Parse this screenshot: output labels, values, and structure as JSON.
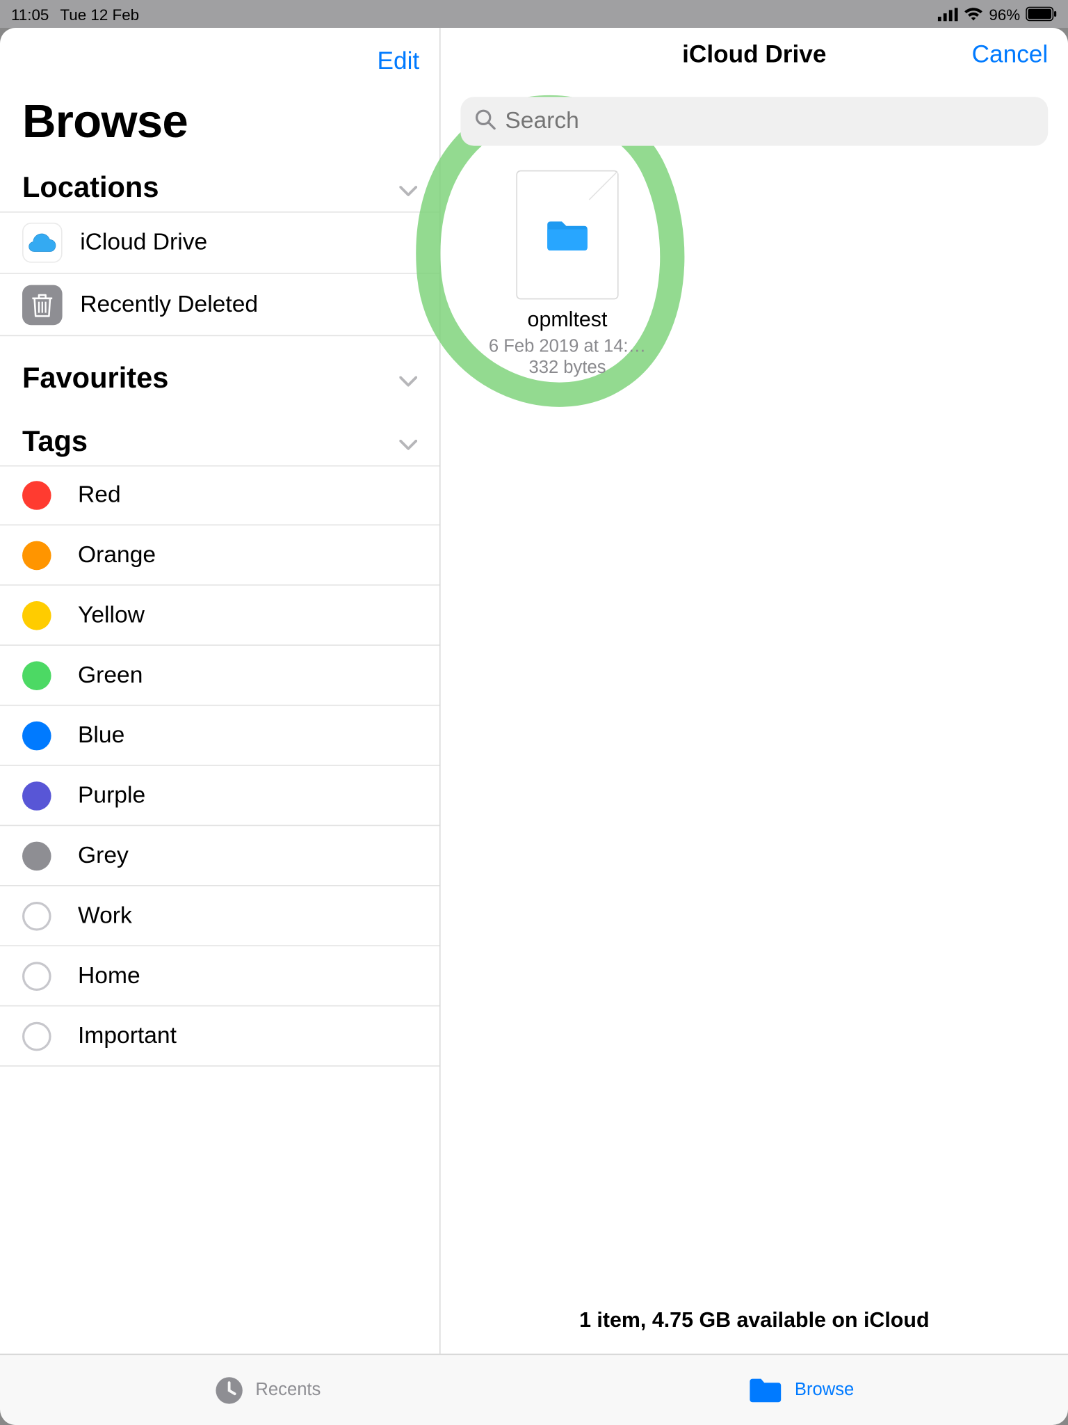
{
  "status_bar": {
    "time": "11:05",
    "date": "Tue 12 Feb",
    "battery_percent": "96%"
  },
  "sidebar": {
    "edit_label": "Edit",
    "title": "Browse",
    "sections": {
      "locations_label": "Locations",
      "favourites_label": "Favourites",
      "tags_label": "Tags"
    },
    "locations": [
      {
        "label": "iCloud Drive"
      },
      {
        "label": "Recently Deleted"
      }
    ],
    "tags": [
      {
        "label": "Red",
        "color": "#ff3b30",
        "filled": true
      },
      {
        "label": "Orange",
        "color": "#ff9500",
        "filled": true
      },
      {
        "label": "Yellow",
        "color": "#ffcc00",
        "filled": true
      },
      {
        "label": "Green",
        "color": "#4cd964",
        "filled": true
      },
      {
        "label": "Blue",
        "color": "#007aff",
        "filled": true
      },
      {
        "label": "Purple",
        "color": "#5856d6",
        "filled": true
      },
      {
        "label": "Grey",
        "color": "#8e8e93",
        "filled": true
      },
      {
        "label": "Work",
        "color": "",
        "filled": false
      },
      {
        "label": "Home",
        "color": "",
        "filled": false
      },
      {
        "label": "Important",
        "color": "",
        "filled": false
      }
    ]
  },
  "detail": {
    "title": "iCloud Drive",
    "cancel_label": "Cancel",
    "search_placeholder": "Search",
    "files": [
      {
        "name": "opmltest",
        "date": "6 Feb 2019 at 14:…",
        "size": "332 bytes"
      }
    ],
    "footer": "1 item, 4.75 GB available on iCloud"
  },
  "tabbar": {
    "recents_label": "Recents",
    "browse_label": "Browse"
  }
}
